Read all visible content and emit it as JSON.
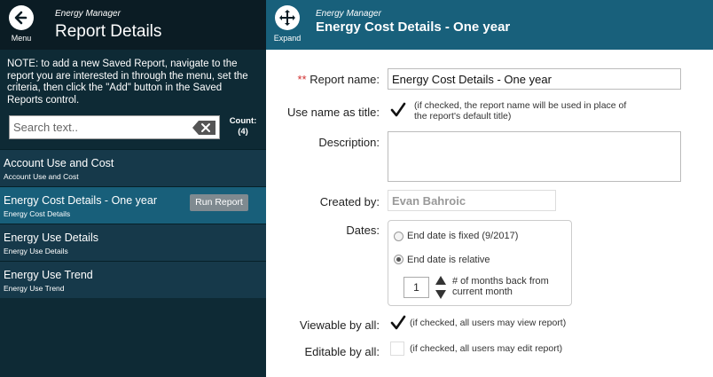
{
  "left_header": {
    "menu_label": "Menu",
    "app_name": "Energy Manager",
    "title": "Report Details"
  },
  "note": "NOTE: to add a new Saved Report, navigate to the report you are interested in through the menu, set the criteria, then click the \"Add\" button in the Saved Reports control.",
  "search": {
    "placeholder": "Search text..",
    "value": ""
  },
  "count": {
    "label": "Count:",
    "value": "(4)"
  },
  "reports": [
    {
      "title": "Account Use and Cost",
      "subtitle": "Account Use and Cost"
    },
    {
      "title": "Energy Cost Details - One year",
      "subtitle": "Energy Cost Details",
      "run_label": "Run Report"
    },
    {
      "title": "Energy Use Details",
      "subtitle": "Energy Use Details"
    },
    {
      "title": "Energy Use Trend",
      "subtitle": "Energy Use Trend"
    }
  ],
  "right_header": {
    "expand_label": "Expand",
    "app_name": "Energy Manager",
    "title": "Energy Cost Details - One year"
  },
  "form": {
    "required_marker": "**",
    "report_name_label": "Report name:",
    "report_name_value": "Energy Cost Details - One year",
    "use_name_label": "Use name as title:",
    "use_name_hint_1": "(if checked, the report name will be used in place of",
    "use_name_hint_2": "the report's default title)",
    "description_label": "Description:",
    "description_value": "",
    "created_by_label": "Created by:",
    "created_by_value": "Evan Bahroic",
    "dates_label": "Dates:",
    "fixed_label": "End date is fixed (9/2017)",
    "relative_label": "End date is relative",
    "months_value": "1",
    "months_hint_1": "# of months back from",
    "months_hint_2": "current month",
    "viewable_label": "Viewable by all:",
    "viewable_hint": "(if checked, all users may view report)",
    "editable_label": "Editable by all:",
    "editable_hint": "(if checked, all users may edit report)"
  },
  "colors": {
    "left_panel": "#0e2a35",
    "active_row": "#185f7a",
    "right_header": "#18607b",
    "required": "#d03030"
  }
}
